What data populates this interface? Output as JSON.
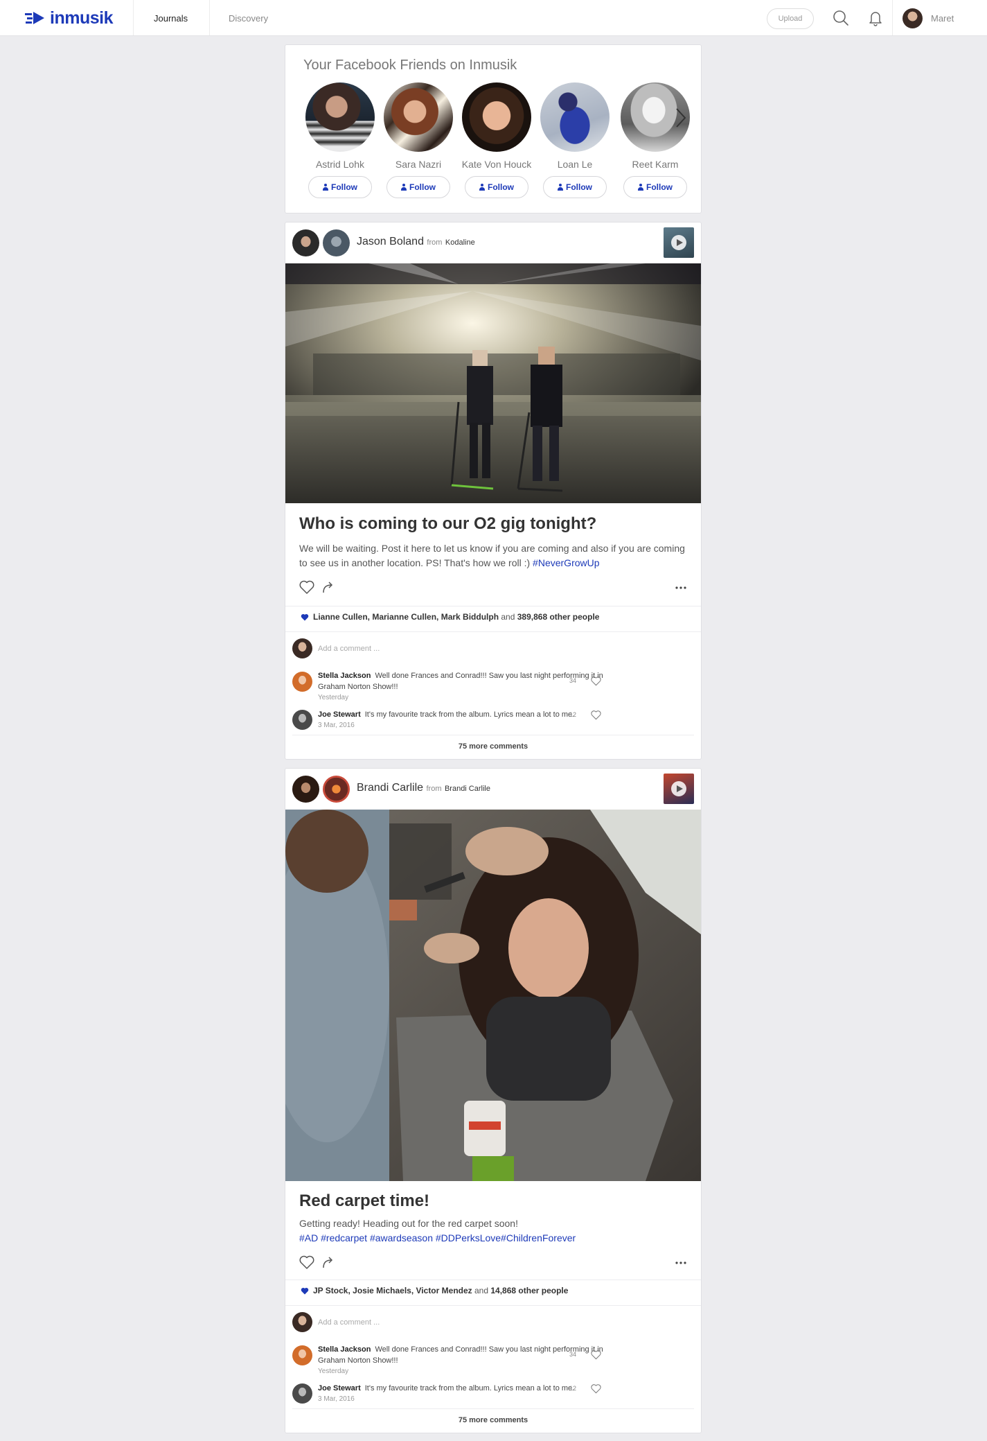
{
  "header": {
    "logo_text": "inmusik",
    "nav": [
      "Journals",
      "Discovery"
    ],
    "upload_label": "Upload",
    "user_name": "Maret",
    "icons": [
      "search-icon",
      "bell-icon"
    ]
  },
  "friends": {
    "title": "Your Facebook Friends on Inmusik",
    "follow_label": "Follow",
    "items": [
      {
        "name": "Astrid Lohk"
      },
      {
        "name": "Sara Nazri"
      },
      {
        "name": "Kate Von Houck"
      },
      {
        "name": "Loan Le"
      },
      {
        "name": "Reet Karm"
      }
    ]
  },
  "posts": [
    {
      "author": "Jason Boland",
      "from": "from",
      "band": "Kodaline",
      "title": "Who is coming to our O2 gig tonight?",
      "body": "We will be waiting. Post it here to let us know if you are coming and also if you are coming to see us in another location. PS! That's how we roll :) ",
      "hashtags": "#NeverGrowUp",
      "likes_names": "Lianne Cullen, Marianne Cullen, Mark Biddulph",
      "likes_and": "and",
      "likes_count": "389,868 other people",
      "comment_placeholder": "Add a comment ...",
      "comments": [
        {
          "author": "Stella Jackson",
          "text": "Well done Frances and Conrad!!! Saw you last night performing it in Graham Norton Show!!!",
          "time": "Yesterday",
          "likes": "34"
        },
        {
          "author": "Joe Stewart",
          "text": "It's my favourite track from the album. Lyrics mean a lot to me.",
          "time": "3 Mar, 2016",
          "likes": "12"
        }
      ],
      "more_comments": "75 more comments"
    },
    {
      "author": "Brandi Carlile",
      "from": "from",
      "band": "Brandi Carlile",
      "title": "Red carpet time!",
      "body": "Getting ready! Heading out for the red carpet soon!",
      "hashtags": "#AD #redcarpet #awardseason #DDPerksLove#ChildrenForever",
      "likes_names": "JP Stock, Josie Michaels, Victor Mendez",
      "likes_and": "and",
      "likes_count": "14,868 other people",
      "comment_placeholder": "Add a comment ...",
      "comments": [
        {
          "author": "Stella Jackson",
          "text": "Well done Frances and Conrad!!! Saw you last night performing it in Graham Norton Show!!!",
          "time": "Yesterday",
          "likes": "34"
        },
        {
          "author": "Joe Stewart",
          "text": "It's my favourite track from the album. Lyrics mean a lot to me.",
          "time": "3 Mar, 2016",
          "likes": "12"
        }
      ],
      "more_comments": "75 more comments"
    }
  ],
  "colors": {
    "brand": "#1d3ab8",
    "background": "#ececef",
    "link": "#1d3ab8"
  }
}
